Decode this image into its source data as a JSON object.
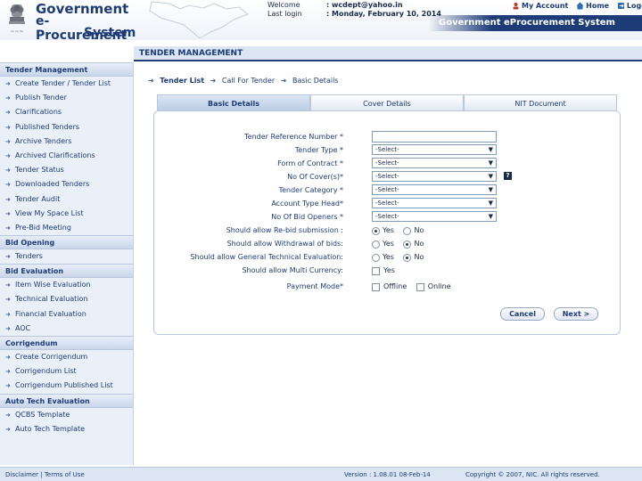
{
  "header": {
    "brand": [
      "Government",
      "e-Procurement",
      "System"
    ],
    "welcome_label": "Welcome",
    "welcome_value": ": wcdept@yahoo.in",
    "last_login_label": "Last login",
    "last_login_value": ": Monday, February 10, 2014",
    "nav": [
      "My Account",
      "Home",
      "Logout"
    ],
    "banner_title": "Government eProcurement System"
  },
  "page_title": "TENDER MANAGEMENT",
  "sidebar": {
    "sections": [
      {
        "title": "Tender Management",
        "items": [
          "Create Tender / Tender List",
          "Publish Tender",
          "Clarifications",
          "Published Tenders",
          "Archive Tenders",
          "Archived Clarifications",
          "Tender Status",
          "Downloaded Tenders",
          "Tender Audit",
          "View My Space List",
          "Pre-Bid Meeting"
        ]
      },
      {
        "title": "Bid Opening",
        "items": [
          "Tenders"
        ]
      },
      {
        "title": "Bid Evaluation",
        "items": [
          "Item Wise Evaluation",
          "Technical Evaluation",
          "Financial Evaluation",
          "AOC"
        ]
      },
      {
        "title": "Corrigendum",
        "items": [
          "Create Corrigendum",
          "Corrigendum List",
          "Corrigendum Published List"
        ]
      },
      {
        "title": "Auto Tech Evaluation",
        "items": [
          "QCBS Template",
          "Auto Tech Template"
        ]
      }
    ]
  },
  "breadcrumb": [
    "Tender List",
    "Call For Tender",
    "Basic Details"
  ],
  "tabs": [
    "Basic Details",
    "Cover Details",
    "NIT Document"
  ],
  "form": {
    "tender_ref_label": "Tender Reference Number *",
    "tender_ref_value": "",
    "tender_type_label": "Tender Type *",
    "tender_type_value": "-Select-",
    "form_contract_label": "Form of Contract *",
    "form_contract_value": "-Select-",
    "no_covers_label": "No Of Cover(s)*",
    "no_covers_value": "-Select-",
    "tender_category_label": "Tender Category *",
    "tender_category_value": "-Select-",
    "account_type_label": "Account Type Head*",
    "account_type_value": "-Select-",
    "bid_openers_label": "No Of Bid Openers *",
    "bid_openers_value": "-Select-",
    "rebid_label": "Should allow Re-bid submission :",
    "withdrawal_label": "Should allow Withdrawal of bids:",
    "general_tech_label": "Should allow General Technical Evaluation:",
    "multi_currency_label": "Should allow Multi Currency:",
    "payment_mode_label": "Payment Mode*",
    "yes": "Yes",
    "no": "No",
    "offline": "Offline",
    "online": "Online",
    "cancel": "Cancel",
    "next": "Next >"
  },
  "footer": {
    "disclaimer": "Disclaimer",
    "terms": "Terms of Use",
    "version": "Version : 1.08.01 08-Feb-14",
    "copyright": "Copyright © 2007, NIC. All rights reserved."
  }
}
